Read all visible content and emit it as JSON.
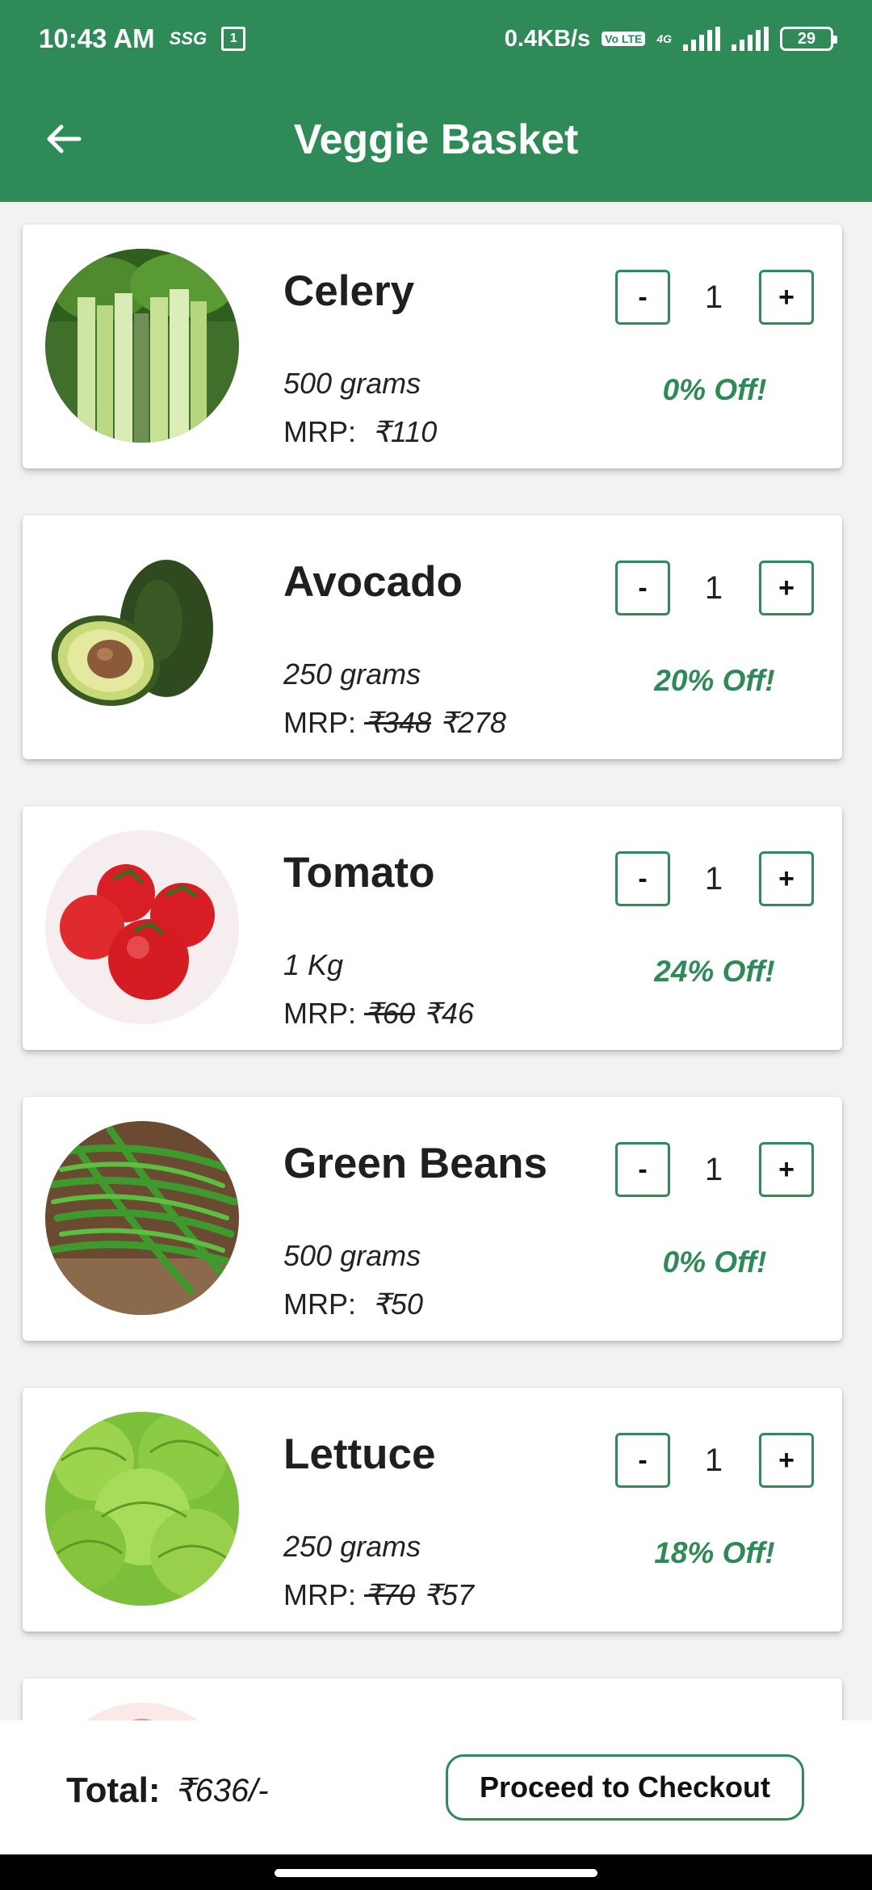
{
  "status_bar": {
    "time": "10:43 AM",
    "carrier_tag": "SSG",
    "notif_badge": "1",
    "net_speed": "0.4KB/s",
    "volte": "Vo LTE",
    "network_type": "4G",
    "battery": "29"
  },
  "app_bar": {
    "title": "Veggie Basket",
    "back_icon": "arrow-left-icon"
  },
  "products": [
    {
      "name": "Celery",
      "weight": "500 grams",
      "mrp_label": "MRP: ",
      "old_price": "",
      "price": "₹110",
      "quantity": "1",
      "discount": "0% Off!",
      "image": "celery"
    },
    {
      "name": "Avocado",
      "weight": "250 grams",
      "mrp_label": "MRP: ",
      "old_price": "₹348",
      "price": "₹278",
      "quantity": "1",
      "discount": "20% Off!",
      "image": "avocado"
    },
    {
      "name": "Tomato",
      "weight": "1 Kg",
      "mrp_label": "MRP: ",
      "old_price": "₹60",
      "price": "₹46",
      "quantity": "1",
      "discount": "24% Off!",
      "image": "tomato"
    },
    {
      "name": "Green Beans",
      "weight": "500 grams",
      "mrp_label": "MRP: ",
      "old_price": "",
      "price": "₹50",
      "quantity": "1",
      "discount": "0% Off!",
      "image": "green-beans"
    },
    {
      "name": "Lettuce",
      "weight": "250 grams",
      "mrp_label": "MRP: ",
      "old_price": "₹70",
      "price": "₹57",
      "quantity": "1",
      "discount": "18% Off!",
      "image": "lettuce"
    }
  ],
  "controls": {
    "minus": "-",
    "plus": "+"
  },
  "footer": {
    "total_label": "Total:",
    "total_value": "₹636/-",
    "checkout_label": "Proceed to Checkout"
  },
  "colors": {
    "primary": "#2e8b57",
    "background": "#f2f2f2"
  }
}
